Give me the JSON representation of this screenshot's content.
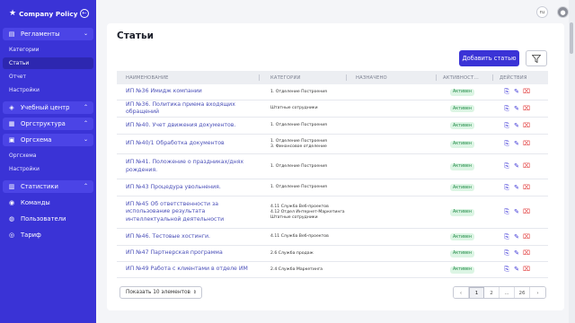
{
  "brand": {
    "name": "Company Policy"
  },
  "sidebar": {
    "sections": [
      {
        "label": "Регламенты",
        "expanded": true
      },
      {
        "label": "Учебный центр",
        "expanded": false
      },
      {
        "label": "Оргструктура",
        "expanded": false
      },
      {
        "label": "Оргсхема",
        "expanded": true
      },
      {
        "label": "Статистики",
        "expanded": false
      }
    ],
    "reglament_items": [
      "Категории",
      "Статьи",
      "Отчет",
      "Настройки"
    ],
    "orgscheme_items": [
      "Оргсхема",
      "Настройки"
    ],
    "bottom_items": [
      "Команды",
      "Пользователи",
      "Тариф"
    ]
  },
  "topbar": {
    "lang": "ru"
  },
  "main": {
    "title": "Статьи",
    "add_button": "Добавить статью",
    "columns": [
      "НАИМЕНОВАНИЕ",
      "КАТЕГОРИИ",
      "НАЗНАЧЕНО",
      "АКТИВНОСТ...",
      "ДЕЙСТВИЯ"
    ],
    "rows": [
      {
        "name": "ИП №36 Имидж компании",
        "cats": [
          "1. Отделение Построения"
        ],
        "status": "Активен"
      },
      {
        "name": "ИП №36. Политика приема входящих обращений",
        "cats": [
          "Штатные сотрудники"
        ],
        "status": "Активен"
      },
      {
        "name": "ИП №40. Учет движения документов.",
        "cats": [
          "1. Отделение Построения"
        ],
        "status": "Активен"
      },
      {
        "name": "ИП №40/1 Обработка документов",
        "cats": [
          "1. Отделение Построения",
          "3. Финансовое отделение"
        ],
        "status": "Активен"
      },
      {
        "name": "ИП №41. Положение о праздниках/днях рождения.",
        "cats": [
          "1. Отделение Построения"
        ],
        "status": "Активен"
      },
      {
        "name": "ИП №43 Процедура увольнения.",
        "cats": [
          "1. Отделение Построения"
        ],
        "status": "Активен"
      },
      {
        "name": "ИП №45 Об ответственности за использование результата интеллектуальной деятельности",
        "cats": [
          "4.11 Служба Веб-проектов",
          "4.12 Отдел Интернет-Маркетинга",
          "Штатные сотрудники"
        ],
        "status": "Активен"
      },
      {
        "name": "ИП №46. Тестовые хостинги.",
        "cats": [
          "4.11 Служба Веб-проектов"
        ],
        "status": "Активен"
      },
      {
        "name": "ИП №47 Партнерская программа",
        "cats": [
          "2.6 Служба продаж"
        ],
        "status": "Активен"
      },
      {
        "name": "ИП №49 Работа с клиентами в отделе ИМ",
        "cats": [
          "2.4 Служба Маркетинга"
        ],
        "status": "Активен"
      }
    ],
    "page_size": "Показать 10 элементов",
    "pages": [
      "1",
      "2",
      "...",
      "26"
    ]
  },
  "colors": {
    "accent": "#3a33d6",
    "success_bg": "#dcf5e4",
    "success_text": "#1f8a45",
    "danger": "#e23b3b"
  }
}
